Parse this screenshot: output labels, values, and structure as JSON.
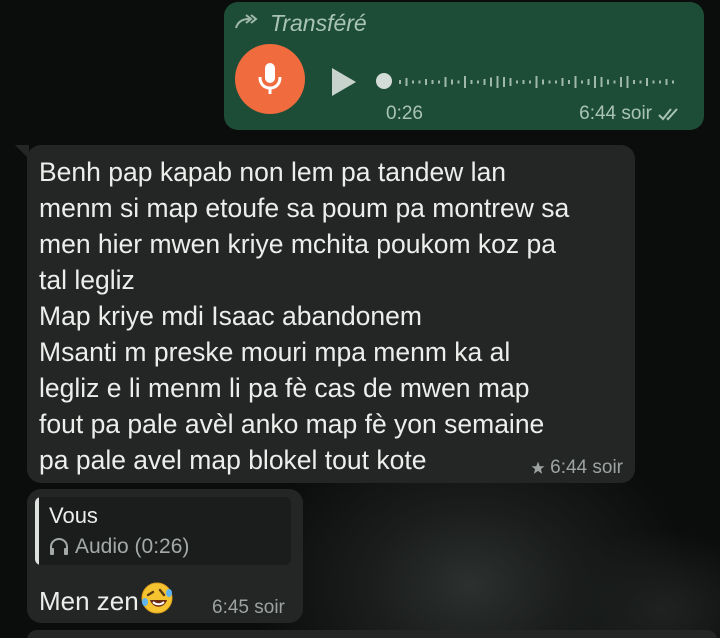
{
  "theme": {
    "outgoing_bubble": "#1e4d37",
    "incoming_bubble": "#242626",
    "mic_button": "#f06b3e",
    "meta_text": "#a9c4b3"
  },
  "voice_message": {
    "forwarded_label": "Transféré",
    "forwarded_icon": "forward-arrow-icon",
    "mic_icon": "microphone-icon",
    "play_icon": "play-icon",
    "duration": "0:26",
    "playback_progress": 0,
    "time": "6:44 soir",
    "status_icon": "double-check-icon"
  },
  "text_message": {
    "body": "Benh pap kapab non lem pa tandew lan\nmenm si map etoufe sa poum pa montrew sa\nmen hier mwen kriye mchita poukom koz pa\ntal legliz\nMap kriye mdi Isaac abandonem\nMsanti m preske mouri mpa menm ka al\nlegliz e li menm li pa fè cas de mwen map\nfout pa pale avèl anko map fè yon semaine\npa pale avel map blokel tout kote",
    "starred_icon": "star-icon",
    "time": "6:44 soir"
  },
  "reply_message": {
    "quoted_author": "Vous",
    "quoted_text": "Audio (0:26)",
    "quoted_icon": "headphones-icon",
    "body": "Men zen",
    "emoji": "rolling-on-floor-laughing-emoji",
    "time": "6:45 soir"
  }
}
